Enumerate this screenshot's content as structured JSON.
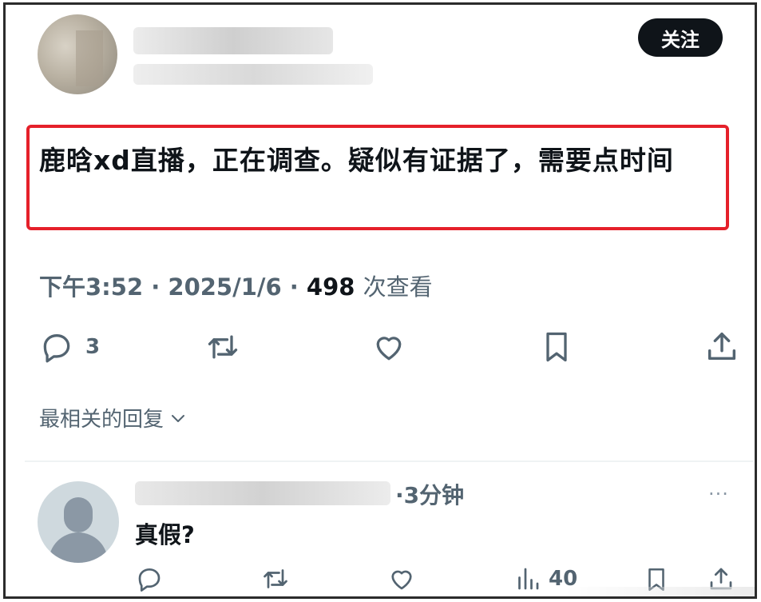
{
  "header": {
    "follow_label": "关注"
  },
  "post": {
    "text": "鹿晗xd直播，正在调查。疑似有证据了，需要点时间",
    "time": "下午3:52",
    "date": "2025/1/6",
    "views": "498",
    "views_label": "次查看",
    "sep": "·"
  },
  "actions": {
    "reply_count": "3",
    "icons": [
      "reply-icon",
      "retweet-icon",
      "like-icon",
      "bookmark-icon",
      "share-icon"
    ]
  },
  "replies": {
    "sort_label": "最相关的回复",
    "items": [
      {
        "time": "·3分钟",
        "more": "···",
        "text": "真假?",
        "views": "40"
      }
    ]
  },
  "colors": {
    "accent": "#0f1419",
    "secondary": "#536471",
    "highlight": "#e5202a"
  }
}
